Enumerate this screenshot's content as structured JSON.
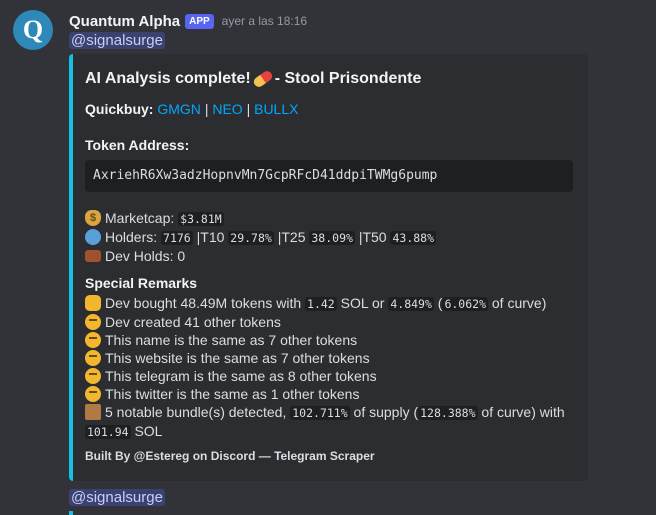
{
  "message": {
    "username": "Quantum Alpha",
    "badge": "APP",
    "timestamp": "ayer a las 18:16",
    "avatar_letter": "Q",
    "mention": "@signalsurge"
  },
  "embed": {
    "accent_color": "#14c1e6",
    "title_before": "AI Analysis complete!",
    "title_after": "- Stool Prisondente",
    "quickbuy_label": "Quickbuy:",
    "quickbuy_links": [
      "GMGN",
      "NEO",
      "BULLX"
    ],
    "token_address_label": "Token Address:",
    "token_address": "AxriehR6Xw3adzHopnvMn7GcpRFcD41ddpiTWMg6pump",
    "marketcap_label": "Marketcap:",
    "marketcap_value": "$3.81M",
    "holders_label": "Holders:",
    "holders_value": "7176",
    "t10_label": "T10",
    "t10_value": "29.78%",
    "t25_label": "T25",
    "t25_value": "38.09%",
    "t50_label": "T50",
    "t50_value": "43.88%",
    "dev_holds": "Dev Holds: 0",
    "special_remarks_label": "Special Remarks",
    "dev_bought_a": "Dev bought 48.49M tokens with",
    "dev_bought_sol": "1.42",
    "dev_bought_b": "SOL or",
    "dev_bought_pct": "4.849%",
    "dev_bought_curve": "6.062%",
    "dev_bought_c": "of curve)",
    "remarks": [
      "Dev created 41 other tokens",
      "This name is the same as 7 other tokens",
      "This website is the same as 7 other tokens",
      "This telegram is the same as 8 other tokens",
      "This twitter is the same as 1 other tokens"
    ],
    "bundle_a": "5 notable bundle(s) detected,",
    "bundle_pct": "102.711%",
    "bundle_b": "of supply (",
    "bundle_curve": "128.388%",
    "bundle_c": "of curve) with",
    "bundle_sol": "101.94",
    "bundle_d": "SOL",
    "footer": "Built By @Estereg on Discord — Telegram Scraper"
  },
  "icons": {
    "title_emoji": "pill-icon",
    "marketcap_emoji": "money-bag-icon",
    "holders_emoji": "people-icon",
    "dev_holds_emoji": "briefcase-icon",
    "dev_bought_emoji": "thumbs-up-icon",
    "remark_emoji": "thinking-face-icon",
    "bundle_emoji": "package-icon"
  }
}
